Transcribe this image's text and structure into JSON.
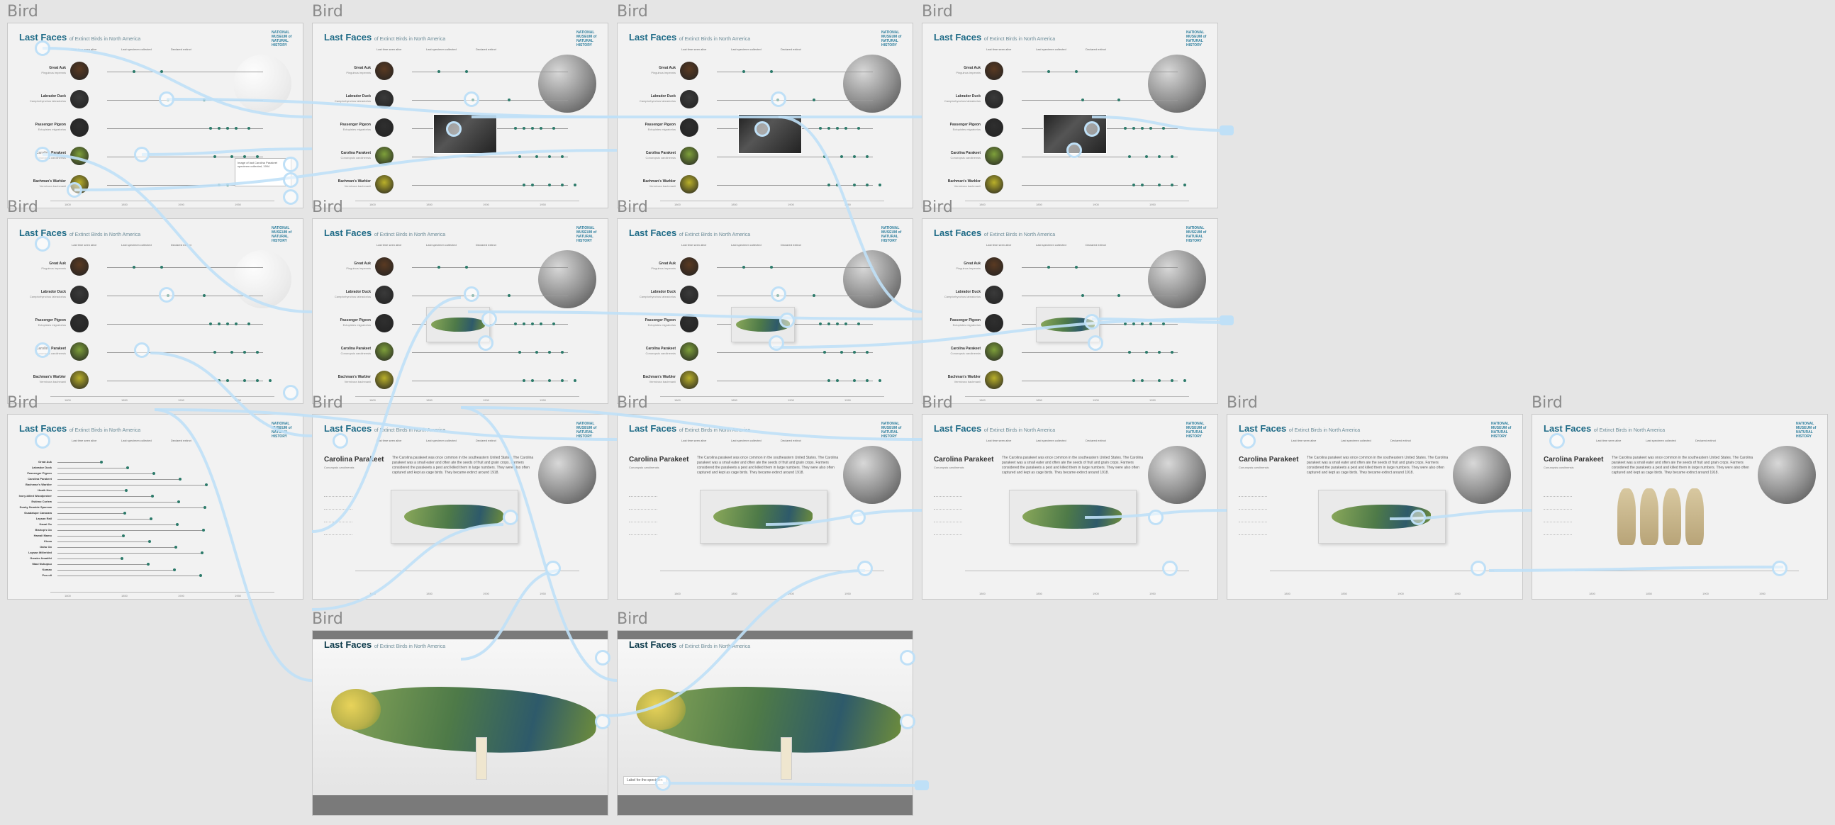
{
  "board": {
    "frame_name": "Bird"
  },
  "header": {
    "title_main": "Last Faces",
    "title_sub": "of Extinct Birds in North America"
  },
  "logo": {
    "line1": "NATIONAL",
    "line2": "MUSEUM of",
    "line3": "NATURAL",
    "line4": "HISTORY"
  },
  "birds": [
    {
      "name": "Great Auk",
      "latin": "Pinguinus impennis"
    },
    {
      "name": "Labrador Duck",
      "latin": "Camptorhynchus labradorius"
    },
    {
      "name": "Passenger Pigeon",
      "latin": "Ectopistes migratorius"
    },
    {
      "name": "Carolina Parakeet",
      "latin": "Conuropsis carolinensis"
    },
    {
      "name": "Bachman's Warbler",
      "latin": "Vermivora bachmanii"
    }
  ],
  "list_birds": [
    "Great Auk",
    "Labrador Duck",
    "Passenger Pigeon",
    "Carolina Parakeet",
    "Bachman's Warbler",
    "Heath Hen",
    "Ivory-billed Woodpecker",
    "Eskimo Curlew",
    "Dusky Seaside Sparrow",
    "Guadalupe Caracara",
    "Laysan Rail",
    "Kauai Oo",
    "Bishop's Oo",
    "Hawaii Mamo",
    "Kioea",
    "Oahu Oo",
    "Laysan Millerbird",
    "Greater Amakihi",
    "Maui Nukupuu",
    "Kamao",
    "Poo-uli"
  ],
  "detail": {
    "title": "Carolina Parakeet",
    "latin": "Conuropsis carolinensis",
    "text": "The Carolina parakeet was once common in the southeastern United States. The Carolina parakeet was a small eater and often ate the seeds of fruit and grain crops. Farmers considered the parakeets a pest and killed them in large numbers. They were also often captured and kept as cage birds. They became extinct around 1918."
  },
  "axis_ticks": [
    "1800",
    "1850",
    "1900",
    "1950"
  ],
  "legend": [
    "Last time seen alive",
    "Last specimen collected",
    "Declared extinct"
  ],
  "popup_text": "Image of last Carolina Parakeet specimen collected, 1904",
  "label_note": "Label for the specimen",
  "colors": {
    "link": "#bfe0f7",
    "accent": "#1d6a86",
    "frame": "#f2f2f2",
    "canvas": "#e5e5e5"
  }
}
